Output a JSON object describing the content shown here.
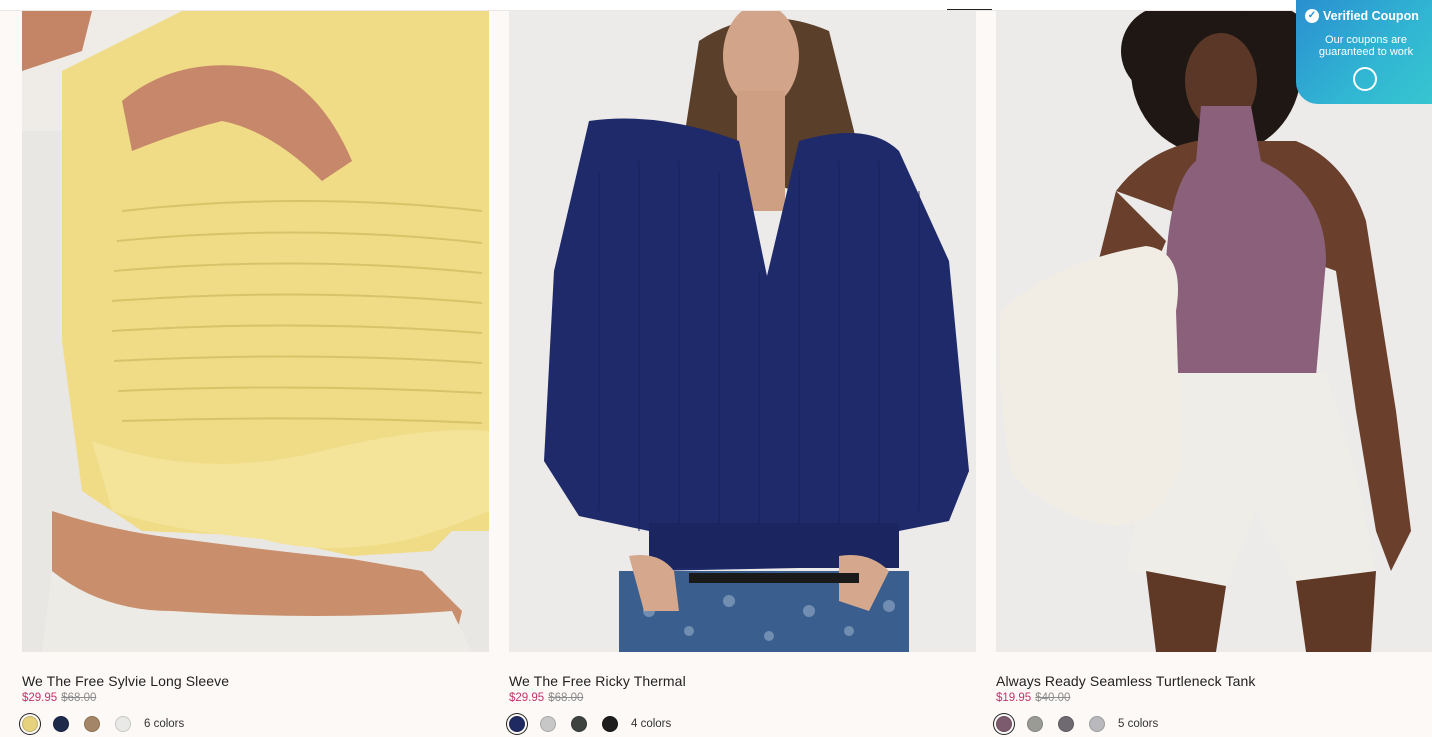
{
  "products": [
    {
      "title": "We The Free Sylvie Long Sleeve",
      "sale_price": "$29.95",
      "original_price": "$68.00",
      "colors_label": "6 colors",
      "swatches": [
        "#e6d27d",
        "#1e2a4a",
        "#a48567",
        "#e9e9e7"
      ],
      "selected_swatch": 0
    },
    {
      "title": "We The Free Ricky Thermal",
      "sale_price": "$29.95",
      "original_price": "$68.00",
      "colors_label": "4 colors",
      "swatches": [
        "#1f2a63",
        "#c7c7c7",
        "#3f4340",
        "#1d1d1d"
      ],
      "selected_swatch": 0
    },
    {
      "title": "Always Ready Seamless Turtleneck Tank",
      "sale_price": "$19.95",
      "original_price": "$40.00",
      "colors_label": "5 colors",
      "swatches": [
        "#7d5b6e",
        "#9b9b95",
        "#6f6a72",
        "#b9b9bd"
      ],
      "selected_swatch": 0
    }
  ],
  "coupon_widget": {
    "title": "Verified Coupon",
    "subtitle": "Our coupons are guaranteed to work"
  },
  "colors": {
    "sale_price": "#c2336b",
    "original_price": "#8b8b8b",
    "coupon_gradient_start": "#2a8fd0",
    "coupon_gradient_end": "#37c5d0"
  }
}
